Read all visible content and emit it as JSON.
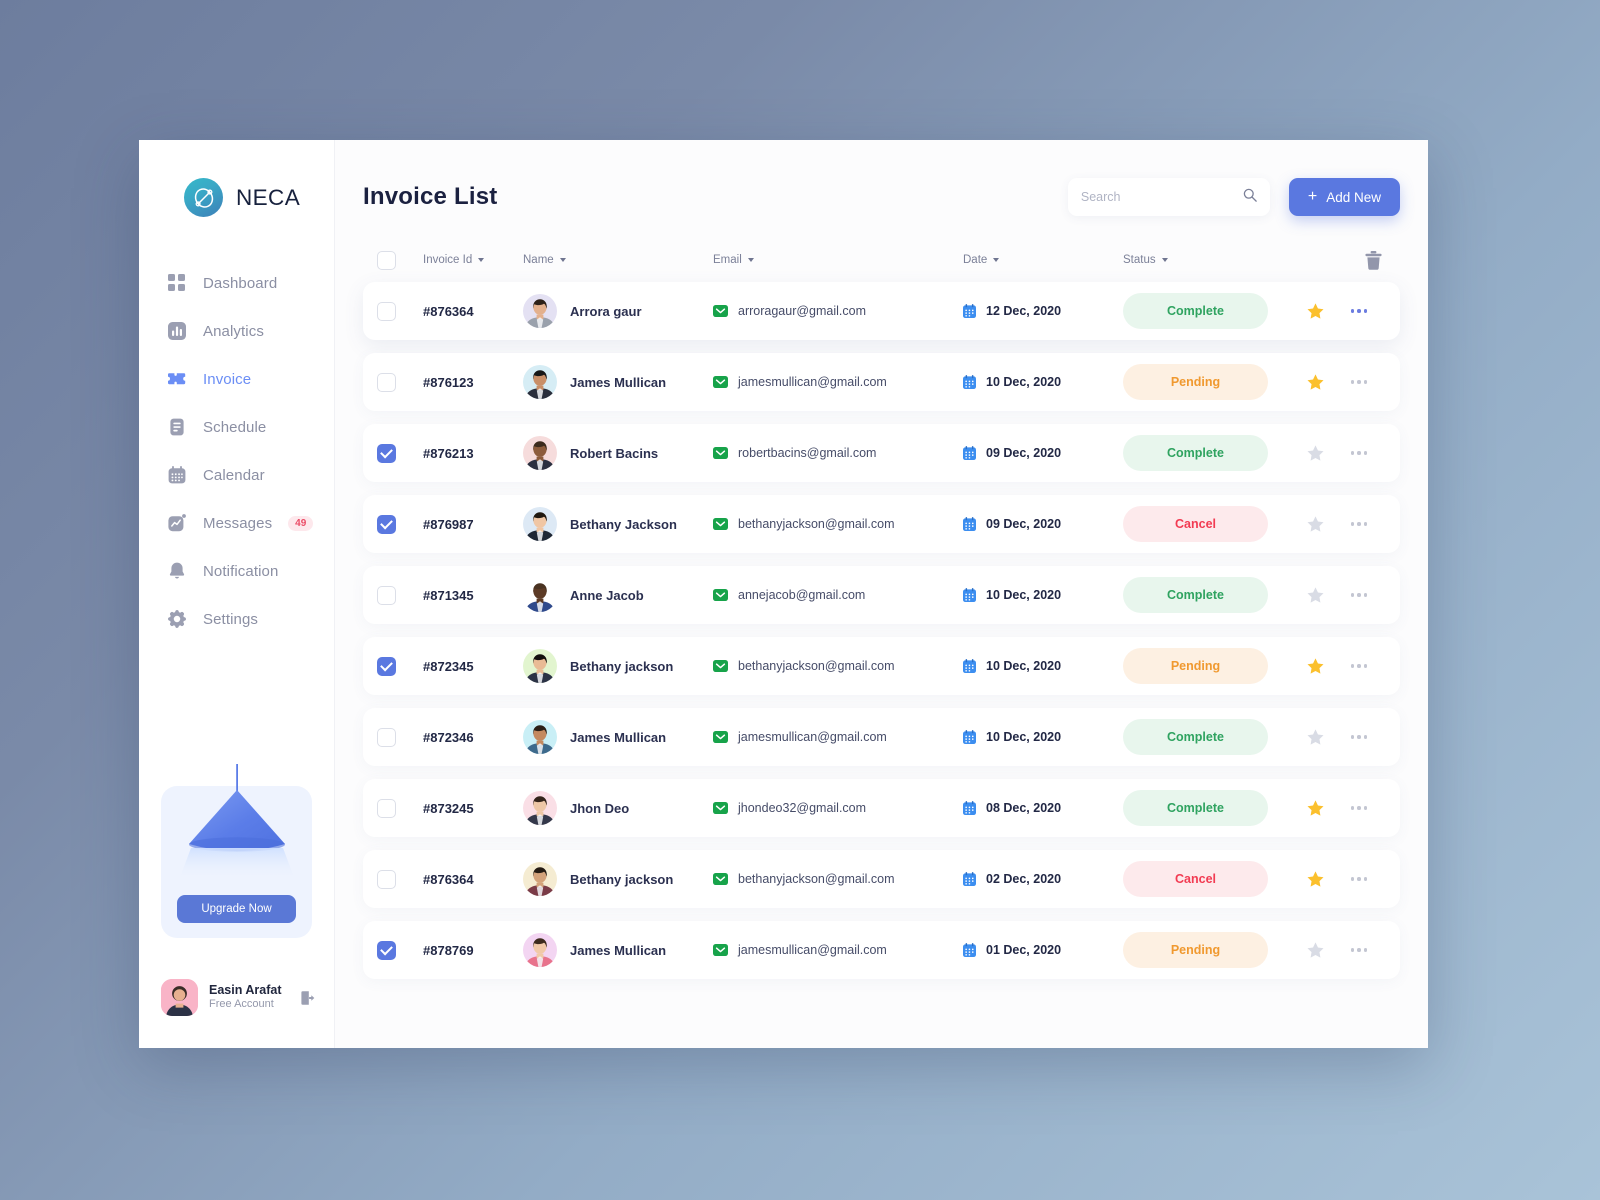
{
  "brand": {
    "name": "NECA",
    "logo_icon": "circle-slash-icon"
  },
  "sidebar": {
    "items": [
      {
        "label": "Dashboard",
        "icon": "grid-icon",
        "active": false,
        "badge": null
      },
      {
        "label": "Analytics",
        "icon": "bar-chart-icon",
        "active": false,
        "badge": null
      },
      {
        "label": "Invoice",
        "icon": "ticket-icon",
        "active": true,
        "badge": null
      },
      {
        "label": "Schedule",
        "icon": "document-icon",
        "active": false,
        "badge": null
      },
      {
        "label": "Calendar",
        "icon": "calendar-icon",
        "active": false,
        "badge": null
      },
      {
        "label": "Messages",
        "icon": "chat-icon",
        "active": false,
        "badge": "49"
      },
      {
        "label": "Notification",
        "icon": "bell-icon",
        "active": false,
        "badge": null
      },
      {
        "label": "Settings",
        "icon": "gear-icon",
        "active": false,
        "badge": null
      }
    ],
    "upgrade": {
      "button_label": "Upgrade Now",
      "illustration": "lamp-icon"
    },
    "profile": {
      "name": "Easin Arafat",
      "plan": "Free Account",
      "logout_icon": "logout-icon"
    }
  },
  "header": {
    "title": "Invoice List",
    "search": {
      "placeholder": "Search",
      "value": "",
      "icon": "search-icon"
    },
    "add_new": {
      "label": "Add New",
      "icon": "plus-icon"
    }
  },
  "table": {
    "columns": [
      {
        "label": "Invoice Id",
        "sortable": true
      },
      {
        "label": "Name",
        "sortable": true
      },
      {
        "label": "Email",
        "sortable": true
      },
      {
        "label": "Date",
        "sortable": true
      },
      {
        "label": "Status",
        "sortable": true
      }
    ],
    "select_all": false,
    "delete_icon": "trash-icon",
    "rows": [
      {
        "checked": false,
        "invoice_id": "#876364",
        "name": "Arrora gaur",
        "email": "arroragaur@gmail.com",
        "date": "12 Dec, 2020",
        "status": "Complete",
        "status_kind": "complete",
        "starred": true,
        "avatar_bg": "#e4e1f3",
        "menu_active": true
      },
      {
        "checked": false,
        "invoice_id": "#876123",
        "name": "James Mullican",
        "email": "jamesmullican@gmail.com",
        "date": "10 Dec, 2020",
        "status": "Pending",
        "status_kind": "pending",
        "starred": true,
        "avatar_bg": "#d6edf5",
        "menu_active": false
      },
      {
        "checked": true,
        "invoice_id": "#876213",
        "name": "Robert Bacins",
        "email": "robertbacins@gmail.com",
        "date": "09 Dec, 2020",
        "status": "Complete",
        "status_kind": "complete",
        "starred": false,
        "avatar_bg": "#f6dcdc",
        "menu_active": false
      },
      {
        "checked": true,
        "invoice_id": "#876987",
        "name": "Bethany Jackson",
        "email": "bethanyjackson@gmail.com",
        "date": "09 Dec, 2020",
        "status": "Cancel",
        "status_kind": "cancel",
        "starred": false,
        "avatar_bg": "#dde9f5",
        "menu_active": false
      },
      {
        "checked": false,
        "invoice_id": "#871345",
        "name": "Anne Jacob",
        "email": "annejacob@gmail.com",
        "date": "10 Dec, 2020",
        "status": "Complete",
        "status_kind": "complete",
        "starred": false,
        "avatar_bg": "#ffffff",
        "menu_active": false
      },
      {
        "checked": true,
        "invoice_id": "#872345",
        "name": "Bethany jackson",
        "email": "bethanyjackson@gmail.com",
        "date": "10 Dec, 2020",
        "status": "Pending",
        "status_kind": "pending",
        "starred": true,
        "avatar_bg": "#e2f5cf",
        "menu_active": false
      },
      {
        "checked": false,
        "invoice_id": "#872346",
        "name": "James Mullican",
        "email": "jamesmullican@gmail.com",
        "date": "10 Dec, 2020",
        "status": "Complete",
        "status_kind": "complete",
        "starred": false,
        "avatar_bg": "#c9eff6",
        "menu_active": false
      },
      {
        "checked": false,
        "invoice_id": "#873245",
        "name": "Jhon Deo",
        "email": "jhondeo32@gmail.com",
        "date": "08 Dec, 2020",
        "status": "Complete",
        "status_kind": "complete",
        "starred": true,
        "avatar_bg": "#fadfe6",
        "menu_active": false
      },
      {
        "checked": false,
        "invoice_id": "#876364",
        "name": "Bethany jackson",
        "email": "bethanyjackson@gmail.com",
        "date": "02 Dec, 2020",
        "status": "Cancel",
        "status_kind": "cancel",
        "starred": true,
        "avatar_bg": "#f5ecd2",
        "menu_active": false
      },
      {
        "checked": true,
        "invoice_id": "#878769",
        "name": "James Mullican",
        "email": "jamesmullican@gmail.com",
        "date": "01 Dec, 2020",
        "status": "Pending",
        "status_kind": "pending",
        "starred": false,
        "avatar_bg": "#f3d5f2",
        "menu_active": false
      }
    ]
  },
  "colors": {
    "accent": "#5a78e0",
    "active_nav": "#6b8ef5",
    "complete_text": "#2fa360",
    "complete_bg": "#e8f6ed",
    "pending_text": "#f0992f",
    "pending_bg": "#fdf0e2",
    "cancel_text": "#f23b52",
    "cancel_bg": "#fdeaec",
    "star_on": "#fbc02d",
    "star_off": "#d9dce5",
    "badge_text": "#eb4d67",
    "badge_bg": "#fde8ec"
  }
}
